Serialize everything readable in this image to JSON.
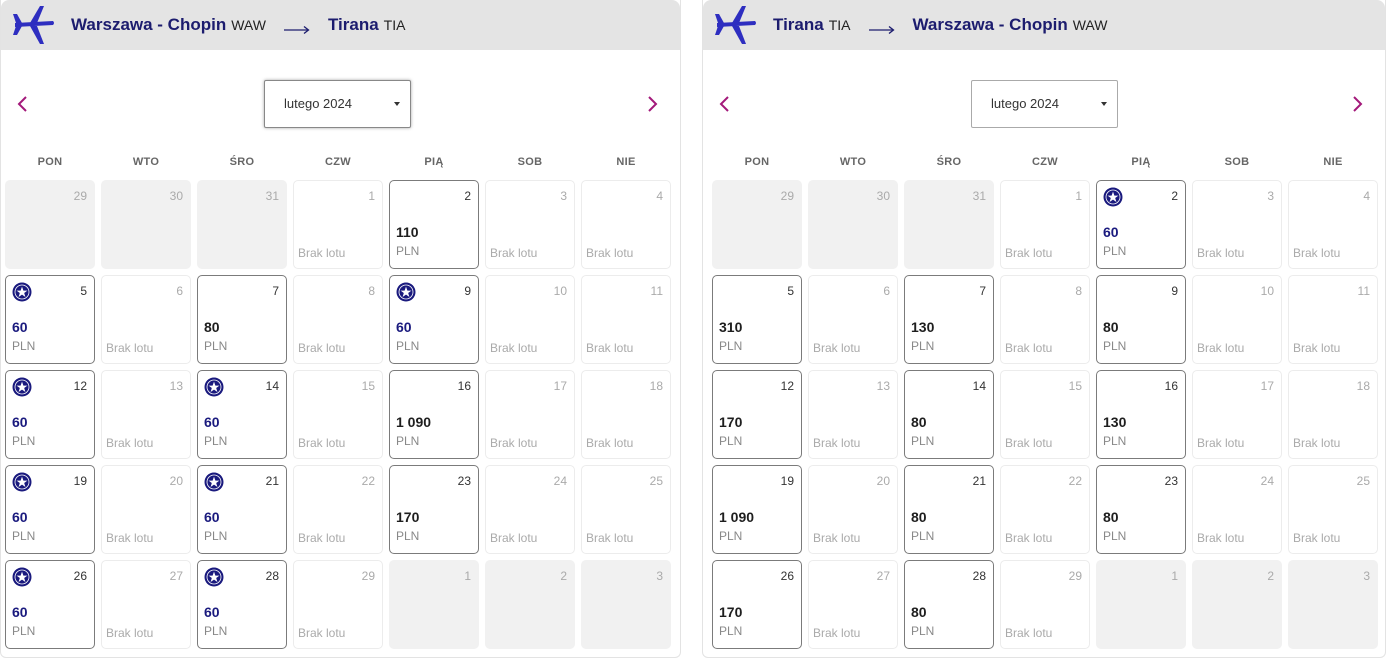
{
  "panels": [
    {
      "id": "outbound",
      "from": {
        "name": "Warszawa - Chopin",
        "code": "WAW"
      },
      "to": {
        "name": "Tirana",
        "code": "TIA"
      },
      "month": "lutego 2024",
      "month_focused": true,
      "weekdays": [
        "PON",
        "WTO",
        "ŚRO",
        "CZW",
        "PIĄ",
        "SOB",
        "NIE"
      ],
      "no_flight_label": "Brak lotu",
      "currency": "PLN",
      "days": [
        {
          "day": "29",
          "state": "past"
        },
        {
          "day": "30",
          "state": "past"
        },
        {
          "day": "31",
          "state": "past"
        },
        {
          "day": "1",
          "state": "none"
        },
        {
          "day": "2",
          "state": "avail",
          "price": "110"
        },
        {
          "day": "3",
          "state": "none"
        },
        {
          "day": "4",
          "state": "none"
        },
        {
          "day": "5",
          "state": "avail",
          "price": "60",
          "promo": true
        },
        {
          "day": "6",
          "state": "none"
        },
        {
          "day": "7",
          "state": "avail",
          "price": "80"
        },
        {
          "day": "8",
          "state": "none"
        },
        {
          "day": "9",
          "state": "avail",
          "price": "60",
          "promo": true
        },
        {
          "day": "10",
          "state": "none"
        },
        {
          "day": "11",
          "state": "none"
        },
        {
          "day": "12",
          "state": "avail",
          "price": "60",
          "promo": true
        },
        {
          "day": "13",
          "state": "none"
        },
        {
          "day": "14",
          "state": "avail",
          "price": "60",
          "promo": true
        },
        {
          "day": "15",
          "state": "none"
        },
        {
          "day": "16",
          "state": "avail",
          "price": "1 090"
        },
        {
          "day": "17",
          "state": "none"
        },
        {
          "day": "18",
          "state": "none"
        },
        {
          "day": "19",
          "state": "avail",
          "price": "60",
          "promo": true
        },
        {
          "day": "20",
          "state": "none"
        },
        {
          "day": "21",
          "state": "avail",
          "price": "60",
          "promo": true
        },
        {
          "day": "22",
          "state": "none"
        },
        {
          "day": "23",
          "state": "avail",
          "price": "170"
        },
        {
          "day": "24",
          "state": "none"
        },
        {
          "day": "25",
          "state": "none"
        },
        {
          "day": "26",
          "state": "avail",
          "price": "60",
          "promo": true
        },
        {
          "day": "27",
          "state": "none"
        },
        {
          "day": "28",
          "state": "avail",
          "price": "60",
          "promo": true
        },
        {
          "day": "29",
          "state": "none"
        },
        {
          "day": "1",
          "state": "past"
        },
        {
          "day": "2",
          "state": "past"
        },
        {
          "day": "3",
          "state": "past"
        }
      ]
    },
    {
      "id": "return",
      "from": {
        "name": "Tirana",
        "code": "TIA"
      },
      "to": {
        "name": "Warszawa - Chopin",
        "code": "WAW"
      },
      "month": "lutego 2024",
      "month_focused": false,
      "weekdays": [
        "PON",
        "WTO",
        "ŚRO",
        "CZW",
        "PIĄ",
        "SOB",
        "NIE"
      ],
      "no_flight_label": "Brak lotu",
      "currency": "PLN",
      "days": [
        {
          "day": "29",
          "state": "past"
        },
        {
          "day": "30",
          "state": "past"
        },
        {
          "day": "31",
          "state": "past"
        },
        {
          "day": "1",
          "state": "none"
        },
        {
          "day": "2",
          "state": "avail",
          "price": "60",
          "promo": true
        },
        {
          "day": "3",
          "state": "none"
        },
        {
          "day": "4",
          "state": "none"
        },
        {
          "day": "5",
          "state": "avail",
          "price": "310"
        },
        {
          "day": "6",
          "state": "none"
        },
        {
          "day": "7",
          "state": "avail",
          "price": "130"
        },
        {
          "day": "8",
          "state": "none"
        },
        {
          "day": "9",
          "state": "avail",
          "price": "80"
        },
        {
          "day": "10",
          "state": "none"
        },
        {
          "day": "11",
          "state": "none"
        },
        {
          "day": "12",
          "state": "avail",
          "price": "170"
        },
        {
          "day": "13",
          "state": "none"
        },
        {
          "day": "14",
          "state": "avail",
          "price": "80"
        },
        {
          "day": "15",
          "state": "none"
        },
        {
          "day": "16",
          "state": "avail",
          "price": "130"
        },
        {
          "day": "17",
          "state": "none"
        },
        {
          "day": "18",
          "state": "none"
        },
        {
          "day": "19",
          "state": "avail",
          "price": "1 090"
        },
        {
          "day": "20",
          "state": "none"
        },
        {
          "day": "21",
          "state": "avail",
          "price": "80"
        },
        {
          "day": "22",
          "state": "none"
        },
        {
          "day": "23",
          "state": "avail",
          "price": "80"
        },
        {
          "day": "24",
          "state": "none"
        },
        {
          "day": "25",
          "state": "none"
        },
        {
          "day": "26",
          "state": "avail",
          "price": "170"
        },
        {
          "day": "27",
          "state": "none"
        },
        {
          "day": "28",
          "state": "avail",
          "price": "80"
        },
        {
          "day": "29",
          "state": "none"
        },
        {
          "day": "1",
          "state": "past"
        },
        {
          "day": "2",
          "state": "past"
        },
        {
          "day": "3",
          "state": "past"
        }
      ]
    }
  ],
  "colors": {
    "brand": "#1c1c6e",
    "accent": "#a3197a",
    "promo_price": "#1a1a7e",
    "header_bg": "#e4e4e4"
  },
  "icons": {
    "plane": "plane-icon",
    "promo": "star-badge-icon",
    "prev": "chevron-left-icon",
    "next": "chevron-right-icon",
    "arrow": "arrow-right-icon"
  }
}
